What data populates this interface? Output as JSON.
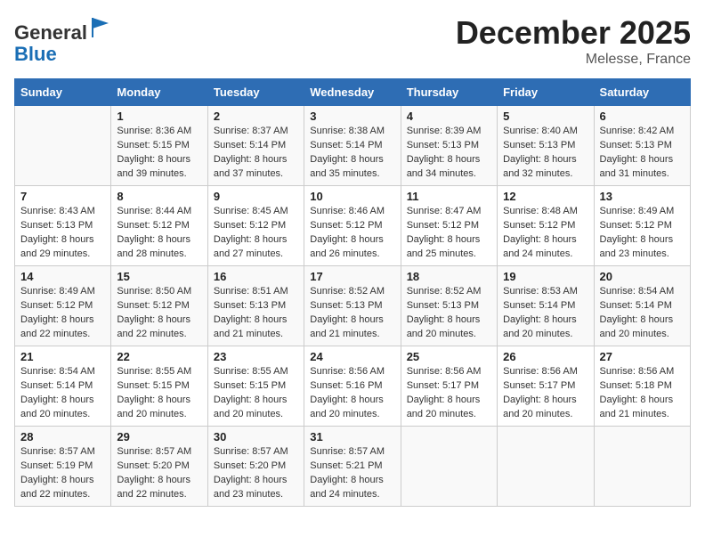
{
  "header": {
    "logo_line1": "General",
    "logo_line2": "Blue",
    "month": "December 2025",
    "location": "Melesse, France"
  },
  "weekdays": [
    "Sunday",
    "Monday",
    "Tuesday",
    "Wednesday",
    "Thursday",
    "Friday",
    "Saturday"
  ],
  "weeks": [
    [
      {
        "day": "",
        "info": ""
      },
      {
        "day": "1",
        "info": "Sunrise: 8:36 AM\nSunset: 5:15 PM\nDaylight: 8 hours\nand 39 minutes."
      },
      {
        "day": "2",
        "info": "Sunrise: 8:37 AM\nSunset: 5:14 PM\nDaylight: 8 hours\nand 37 minutes."
      },
      {
        "day": "3",
        "info": "Sunrise: 8:38 AM\nSunset: 5:14 PM\nDaylight: 8 hours\nand 35 minutes."
      },
      {
        "day": "4",
        "info": "Sunrise: 8:39 AM\nSunset: 5:13 PM\nDaylight: 8 hours\nand 34 minutes."
      },
      {
        "day": "5",
        "info": "Sunrise: 8:40 AM\nSunset: 5:13 PM\nDaylight: 8 hours\nand 32 minutes."
      },
      {
        "day": "6",
        "info": "Sunrise: 8:42 AM\nSunset: 5:13 PM\nDaylight: 8 hours\nand 31 minutes."
      }
    ],
    [
      {
        "day": "7",
        "info": "Sunrise: 8:43 AM\nSunset: 5:13 PM\nDaylight: 8 hours\nand 29 minutes."
      },
      {
        "day": "8",
        "info": "Sunrise: 8:44 AM\nSunset: 5:12 PM\nDaylight: 8 hours\nand 28 minutes."
      },
      {
        "day": "9",
        "info": "Sunrise: 8:45 AM\nSunset: 5:12 PM\nDaylight: 8 hours\nand 27 minutes."
      },
      {
        "day": "10",
        "info": "Sunrise: 8:46 AM\nSunset: 5:12 PM\nDaylight: 8 hours\nand 26 minutes."
      },
      {
        "day": "11",
        "info": "Sunrise: 8:47 AM\nSunset: 5:12 PM\nDaylight: 8 hours\nand 25 minutes."
      },
      {
        "day": "12",
        "info": "Sunrise: 8:48 AM\nSunset: 5:12 PM\nDaylight: 8 hours\nand 24 minutes."
      },
      {
        "day": "13",
        "info": "Sunrise: 8:49 AM\nSunset: 5:12 PM\nDaylight: 8 hours\nand 23 minutes."
      }
    ],
    [
      {
        "day": "14",
        "info": "Sunrise: 8:49 AM\nSunset: 5:12 PM\nDaylight: 8 hours\nand 22 minutes."
      },
      {
        "day": "15",
        "info": "Sunrise: 8:50 AM\nSunset: 5:12 PM\nDaylight: 8 hours\nand 22 minutes."
      },
      {
        "day": "16",
        "info": "Sunrise: 8:51 AM\nSunset: 5:13 PM\nDaylight: 8 hours\nand 21 minutes."
      },
      {
        "day": "17",
        "info": "Sunrise: 8:52 AM\nSunset: 5:13 PM\nDaylight: 8 hours\nand 21 minutes."
      },
      {
        "day": "18",
        "info": "Sunrise: 8:52 AM\nSunset: 5:13 PM\nDaylight: 8 hours\nand 20 minutes."
      },
      {
        "day": "19",
        "info": "Sunrise: 8:53 AM\nSunset: 5:14 PM\nDaylight: 8 hours\nand 20 minutes."
      },
      {
        "day": "20",
        "info": "Sunrise: 8:54 AM\nSunset: 5:14 PM\nDaylight: 8 hours\nand 20 minutes."
      }
    ],
    [
      {
        "day": "21",
        "info": "Sunrise: 8:54 AM\nSunset: 5:14 PM\nDaylight: 8 hours\nand 20 minutes."
      },
      {
        "day": "22",
        "info": "Sunrise: 8:55 AM\nSunset: 5:15 PM\nDaylight: 8 hours\nand 20 minutes."
      },
      {
        "day": "23",
        "info": "Sunrise: 8:55 AM\nSunset: 5:15 PM\nDaylight: 8 hours\nand 20 minutes."
      },
      {
        "day": "24",
        "info": "Sunrise: 8:56 AM\nSunset: 5:16 PM\nDaylight: 8 hours\nand 20 minutes."
      },
      {
        "day": "25",
        "info": "Sunrise: 8:56 AM\nSunset: 5:17 PM\nDaylight: 8 hours\nand 20 minutes."
      },
      {
        "day": "26",
        "info": "Sunrise: 8:56 AM\nSunset: 5:17 PM\nDaylight: 8 hours\nand 20 minutes."
      },
      {
        "day": "27",
        "info": "Sunrise: 8:56 AM\nSunset: 5:18 PM\nDaylight: 8 hours\nand 21 minutes."
      }
    ],
    [
      {
        "day": "28",
        "info": "Sunrise: 8:57 AM\nSunset: 5:19 PM\nDaylight: 8 hours\nand 22 minutes."
      },
      {
        "day": "29",
        "info": "Sunrise: 8:57 AM\nSunset: 5:20 PM\nDaylight: 8 hours\nand 22 minutes."
      },
      {
        "day": "30",
        "info": "Sunrise: 8:57 AM\nSunset: 5:20 PM\nDaylight: 8 hours\nand 23 minutes."
      },
      {
        "day": "31",
        "info": "Sunrise: 8:57 AM\nSunset: 5:21 PM\nDaylight: 8 hours\nand 24 minutes."
      },
      {
        "day": "",
        "info": ""
      },
      {
        "day": "",
        "info": ""
      },
      {
        "day": "",
        "info": ""
      }
    ]
  ]
}
